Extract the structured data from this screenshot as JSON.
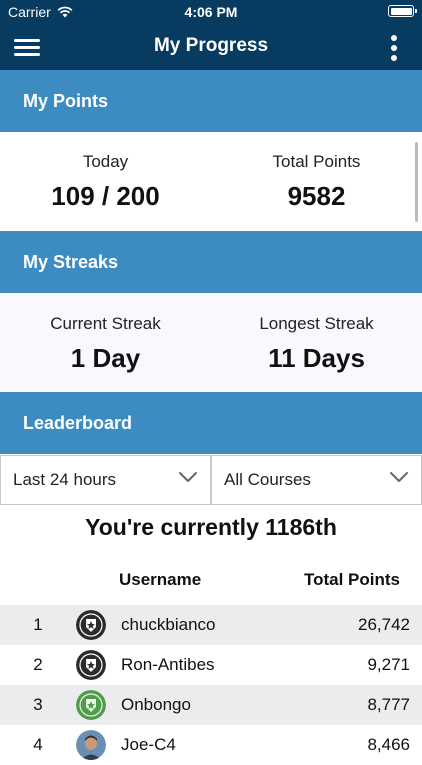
{
  "status_bar": {
    "carrier": "Carrier",
    "time": "4:06 PM"
  },
  "navbar": {
    "title": "My Progress"
  },
  "points": {
    "header": "My Points",
    "today_label": "Today",
    "today_value": "109 / 200",
    "total_label": "Total Points",
    "total_value": "9582"
  },
  "streaks": {
    "header": "My Streaks",
    "current_label": "Current Streak",
    "current_value": "1 Day",
    "longest_label": "Longest Streak",
    "longest_value": "11 Days"
  },
  "leaderboard": {
    "header": "Leaderboard",
    "period_filter": "Last 24 hours",
    "course_filter": "All Courses",
    "rank_message": "You're currently 1186th",
    "col_username": "Username",
    "col_points": "Total Points",
    "rows": [
      {
        "rank": "1",
        "username": "chuckbianco",
        "points": "26,742",
        "avatar": "dark-badge-icon"
      },
      {
        "rank": "2",
        "username": "Ron-Antibes",
        "points": "9,271",
        "avatar": "dark-badge-icon"
      },
      {
        "rank": "3",
        "username": "Onbongo",
        "points": "8,777",
        "avatar": "green-badge-icon"
      },
      {
        "rank": "4",
        "username": "Joe-C4",
        "points": "8,466",
        "avatar": "user-photo"
      }
    ]
  },
  "colors": {
    "navbar": "#073b5f",
    "section_header": "#3c8cc2",
    "badge_dark": "#2b2b2b",
    "badge_green": "#4f9c4a"
  }
}
